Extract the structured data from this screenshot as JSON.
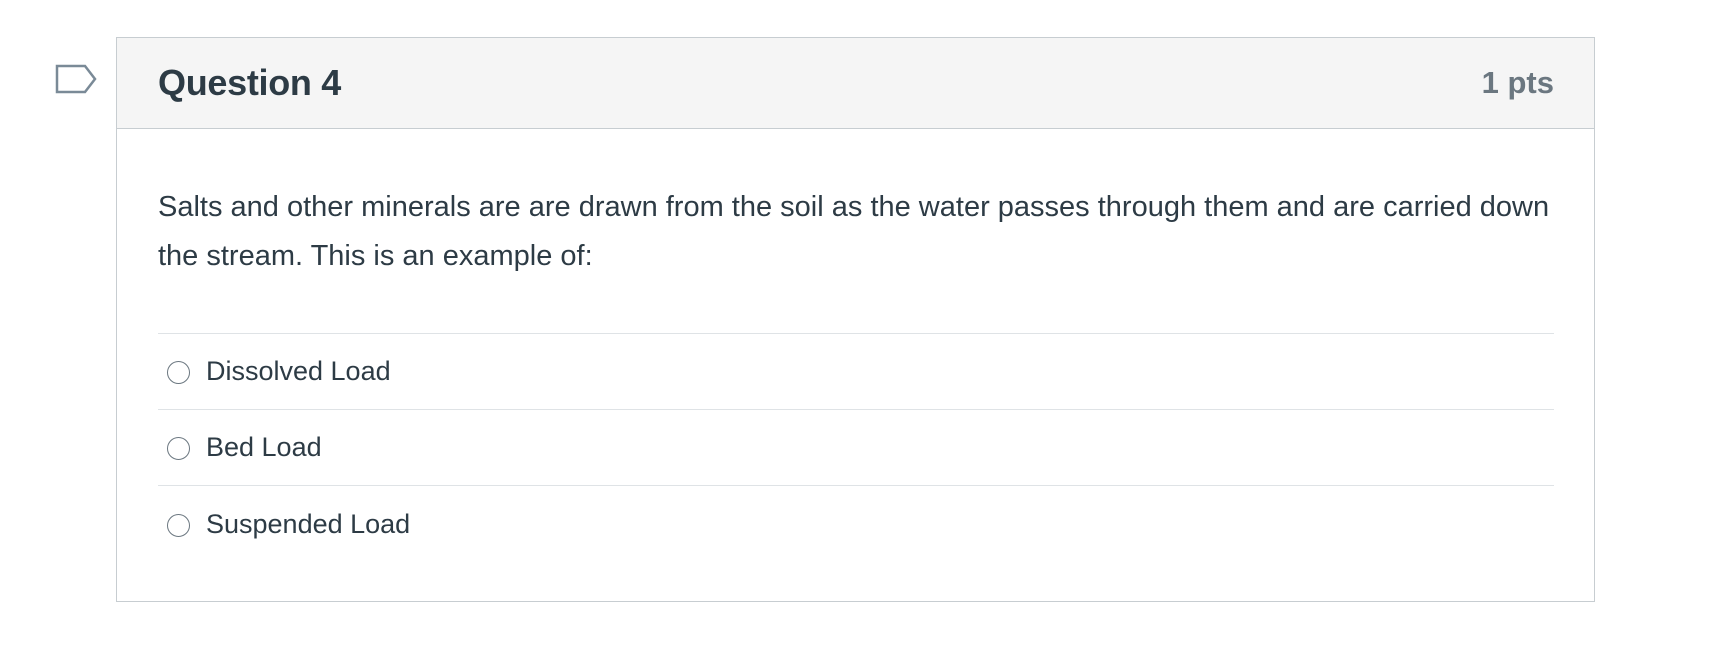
{
  "flag": {
    "icon": "flag-question-icon",
    "color": "#7a8a97"
  },
  "question": {
    "title": "Question 4",
    "points": "1 pts",
    "text": "Salts and other minerals are are drawn from the soil as the water passes through them and are carried down the stream. This is an example of:",
    "answers": [
      {
        "label": "Dissolved Load",
        "selected": false
      },
      {
        "label": "Bed Load",
        "selected": false
      },
      {
        "label": "Suspended Load",
        "selected": false
      }
    ]
  }
}
